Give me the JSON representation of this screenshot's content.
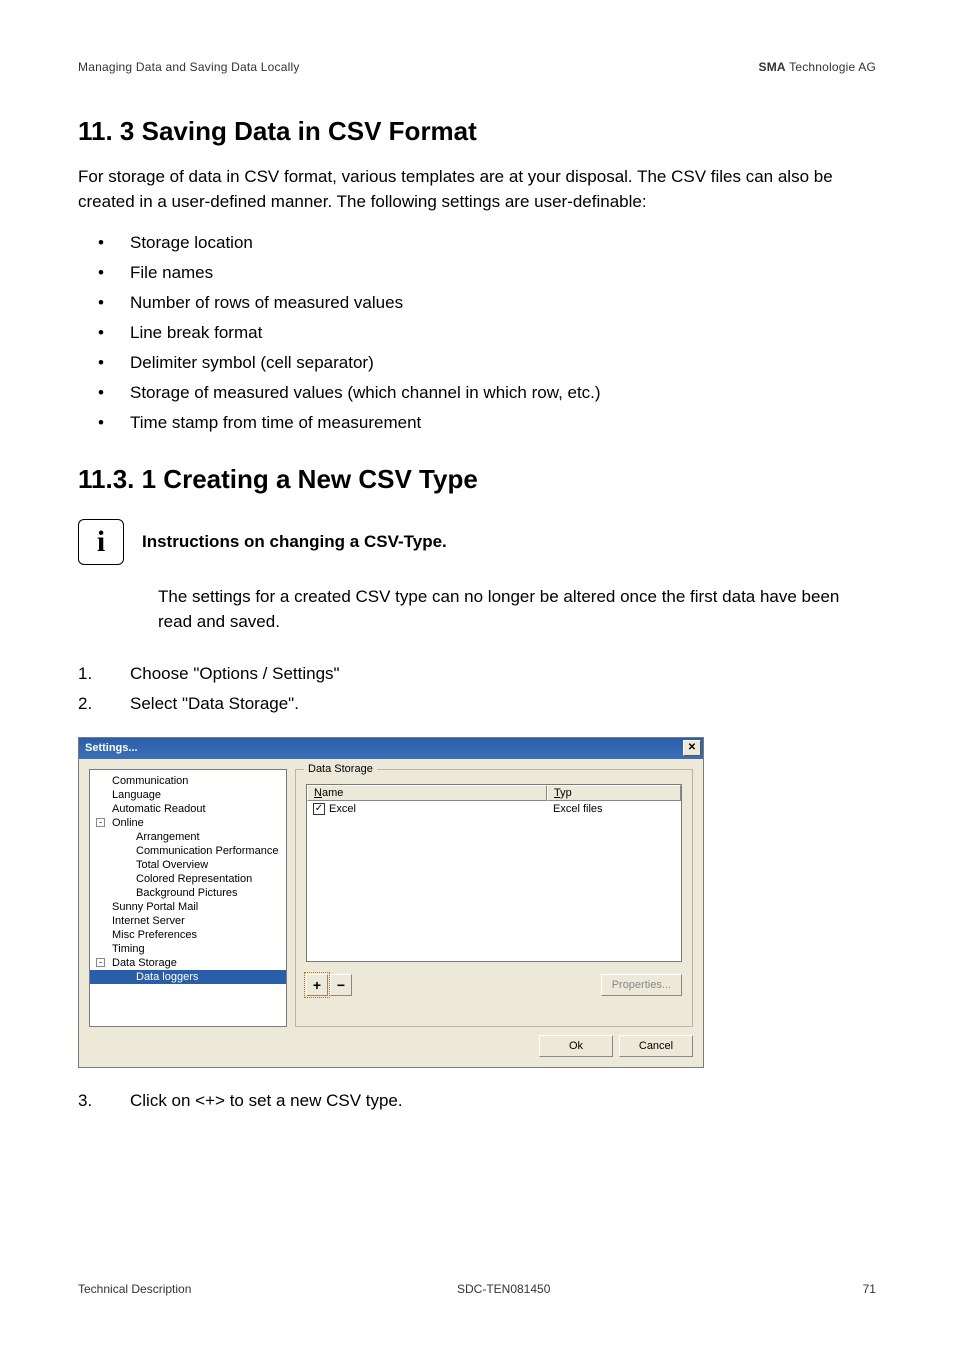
{
  "header": {
    "left": "Managing Data and Saving Data Locally",
    "right_bold": "SMA",
    "right_rest": " Technologie AG"
  },
  "section": {
    "h1": "11. 3 Saving Data in CSV Format",
    "intro": "For storage of data in CSV format, various templates are at your disposal. The CSV files can also be created in a user-defined manner. The following settings are user-definable:",
    "bullets": [
      "Storage location",
      "File names",
      "Number of rows of measured values",
      "Line break format",
      "Delimiter symbol (cell separator)",
      "Storage of measured values (which channel in which row, etc.)",
      "Time stamp from time of measurement"
    ],
    "h2": "11.3. 1 Creating a New CSV Type",
    "info_title": "Instructions on changing a CSV-Type.",
    "info_body": "The settings for a created CSV type can no longer be altered once the first data have been read and saved.",
    "steps": [
      "Choose \"Options / Settings\"",
      "Select \"Data Storage\"."
    ],
    "step_after": "Click on <+> to set a new CSV type."
  },
  "dialog": {
    "title": "Settings...",
    "tree": {
      "items": [
        {
          "label": "Communication",
          "level": 0
        },
        {
          "label": "Language",
          "level": 0
        },
        {
          "label": "Automatic Readout",
          "level": 0
        },
        {
          "label": "Online",
          "level": 0,
          "expander": "-"
        },
        {
          "label": "Arrangement",
          "level": 1
        },
        {
          "label": "Communication Performance",
          "level": 1
        },
        {
          "label": "Total Overview",
          "level": 1
        },
        {
          "label": "Colored Representation",
          "level": 1
        },
        {
          "label": "Background Pictures",
          "level": 1
        },
        {
          "label": "Sunny Portal Mail",
          "level": 0
        },
        {
          "label": "Internet Server",
          "level": 0
        },
        {
          "label": "Misc Preferences",
          "level": 0
        },
        {
          "label": "Timing",
          "level": 0
        },
        {
          "label": "Data Storage",
          "level": 0,
          "expander": "-"
        },
        {
          "label": "Data loggers",
          "level": 1,
          "selected": true
        }
      ]
    },
    "group_legend": "Data Storage",
    "list": {
      "col_name_label": "N",
      "col_name_rest": "ame",
      "col_typ_label": "T",
      "col_typ_rest": "yp",
      "rows": [
        {
          "name": "Excel",
          "typ": "Excel files",
          "checked": true
        }
      ]
    },
    "btn_plus": "+",
    "btn_minus": "−",
    "btn_properties": "Properties...",
    "btn_ok": "Ok",
    "btn_cancel": "Cancel"
  },
  "footer": {
    "left": "Technical Description",
    "mid": "SDC-TEN081450",
    "page": "71"
  },
  "icons": {
    "info_glyph": "i",
    "close_glyph": "✕",
    "check_glyph": "✓"
  }
}
